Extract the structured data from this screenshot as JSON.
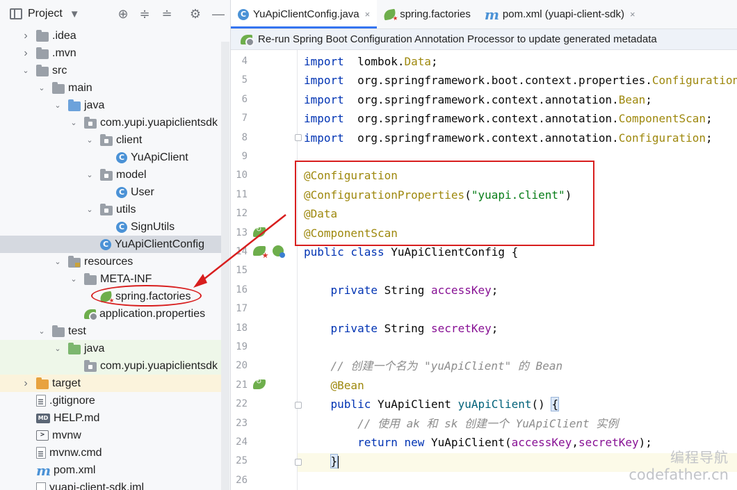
{
  "project_panel": {
    "title": "Project",
    "dropdown_glyph": "▼",
    "tools": [
      "locate-icon",
      "expand-all-icon",
      "collapse-all-icon",
      "gear-icon",
      "minimize-icon"
    ]
  },
  "tree": [
    {
      "label": ".idea",
      "icon": "folder-icon",
      "expanded": false,
      "depth": 0
    },
    {
      "label": ".mvn",
      "icon": "folder-icon",
      "expanded": false,
      "depth": 0
    },
    {
      "label": "src",
      "icon": "folder-icon",
      "expanded": true,
      "depth": 0
    },
    {
      "label": "main",
      "icon": "folder-icon",
      "expanded": true,
      "depth": 1
    },
    {
      "label": "java",
      "icon": "source-folder-icon",
      "expanded": true,
      "depth": 2
    },
    {
      "label": "com.yupi.yuapiclientsdk",
      "icon": "package-icon",
      "expanded": true,
      "depth": 3
    },
    {
      "label": "client",
      "icon": "package-icon",
      "expanded": true,
      "depth": 4
    },
    {
      "label": "YuApiClient",
      "icon": "class-icon",
      "depth": 5
    },
    {
      "label": "model",
      "icon": "package-icon",
      "expanded": true,
      "depth": 4
    },
    {
      "label": "User",
      "icon": "class-icon",
      "depth": 5
    },
    {
      "label": "utils",
      "icon": "package-icon",
      "expanded": true,
      "depth": 4
    },
    {
      "label": "SignUtils",
      "icon": "class-icon",
      "depth": 5
    },
    {
      "label": "YuApiClientConfig",
      "icon": "class-icon",
      "depth": 4,
      "selected": true
    },
    {
      "label": "resources",
      "icon": "resources-folder-icon",
      "expanded": true,
      "depth": 2
    },
    {
      "label": "META-INF",
      "icon": "folder-icon",
      "expanded": true,
      "depth": 3
    },
    {
      "label": "spring.factories",
      "icon": "spring-factories-icon",
      "depth": 4
    },
    {
      "label": "application.properties",
      "icon": "spring-properties-icon",
      "depth": 3
    },
    {
      "label": "test",
      "icon": "folder-icon",
      "expanded": true,
      "depth": 1
    },
    {
      "label": "java",
      "icon": "test-folder-icon",
      "expanded": true,
      "depth": 2,
      "test": true
    },
    {
      "label": "com.yupi.yuapiclientsdk",
      "icon": "package-icon",
      "depth": 3,
      "test": true
    },
    {
      "label": "target",
      "icon": "excluded-folder-icon",
      "expanded": false,
      "depth": 0,
      "target": true
    },
    {
      "label": ".gitignore",
      "icon": "gitignore-icon",
      "depth": 0
    },
    {
      "label": "HELP.md",
      "icon": "markdown-icon",
      "depth": 0
    },
    {
      "label": "mvnw",
      "icon": "script-icon",
      "depth": 0
    },
    {
      "label": "mvnw.cmd",
      "icon": "text-file-icon",
      "depth": 0
    },
    {
      "label": "pom.xml",
      "icon": "maven-icon",
      "depth": 0
    },
    {
      "label": "yuapi-client-sdk.iml",
      "icon": "iml-icon",
      "depth": 0
    }
  ],
  "tabs": [
    {
      "label": "YuApiClientConfig.java",
      "icon": "class-icon",
      "active": true,
      "close": "×"
    },
    {
      "label": "spring.factories",
      "icon": "spring-factories-icon",
      "active": false,
      "close": ""
    },
    {
      "label": "pom.xml (yuapi-client-sdk)",
      "icon": "maven-icon",
      "active": false,
      "close": "×"
    }
  ],
  "banner": {
    "text": "Re-run Spring Boot Configuration Annotation Processor to update generated metadata"
  },
  "icons": {
    "class_letter": "C",
    "markdown_letters": "MD",
    "script_glyph": ">",
    "maven_letter": "m"
  },
  "editor": {
    "current_line": 25,
    "lines": [
      {
        "n": "4",
        "tokens": [
          [
            "kw",
            "import"
          ],
          [
            "",
            "  lombok."
          ],
          [
            "ann",
            "Data"
          ],
          [
            "",
            ";"
          ]
        ]
      },
      {
        "n": "5",
        "tokens": [
          [
            "kw",
            "import"
          ],
          [
            "",
            "  org.springframework.boot.context.properties."
          ],
          [
            "ann",
            "ConfigurationProperties"
          ],
          [
            "",
            ";"
          ]
        ]
      },
      {
        "n": "6",
        "tokens": [
          [
            "kw",
            "import"
          ],
          [
            "",
            "  org.springframework.context.annotation."
          ],
          [
            "ann",
            "Bean"
          ],
          [
            "",
            ";"
          ]
        ]
      },
      {
        "n": "7",
        "tokens": [
          [
            "kw",
            "import"
          ],
          [
            "",
            "  org.springframework.context.annotation."
          ],
          [
            "ann",
            "ComponentScan"
          ],
          [
            "",
            ";"
          ]
        ]
      },
      {
        "n": "8",
        "tokens": [
          [
            "kw",
            "import"
          ],
          [
            "",
            "  org.springframework.context.annotation."
          ],
          [
            "ann",
            "Configuration"
          ],
          [
            "",
            ";"
          ]
        ]
      },
      {
        "n": "9",
        "tokens": []
      },
      {
        "n": "10",
        "tokens": [
          [
            "ann",
            "@Configuration"
          ]
        ]
      },
      {
        "n": "11",
        "tokens": [
          [
            "ann",
            "@ConfigurationProperties"
          ],
          [
            "",
            "("
          ],
          [
            "str",
            "\"yuapi.client\""
          ],
          [
            "",
            ")"
          ]
        ]
      },
      {
        "n": "12",
        "tokens": [
          [
            "ann",
            "@Data"
          ]
        ]
      },
      {
        "n": "13",
        "tokens": [
          [
            "ann",
            "@ComponentScan"
          ]
        ]
      },
      {
        "n": "14",
        "tokens": [
          [
            "kw",
            "public class"
          ],
          [
            "",
            " YuApiClientConfig {"
          ]
        ]
      },
      {
        "n": "15",
        "tokens": []
      },
      {
        "n": "16",
        "tokens": [
          [
            "",
            "    "
          ],
          [
            "kw",
            "private"
          ],
          [
            "",
            " String "
          ],
          [
            "fld",
            "accessKey"
          ],
          [
            "",
            ";"
          ]
        ]
      },
      {
        "n": "17",
        "tokens": []
      },
      {
        "n": "18",
        "tokens": [
          [
            "",
            "    "
          ],
          [
            "kw",
            "private"
          ],
          [
            "",
            " String "
          ],
          [
            "fld",
            "secretKey"
          ],
          [
            "",
            ";"
          ]
        ]
      },
      {
        "n": "19",
        "tokens": []
      },
      {
        "n": "20",
        "tokens": [
          [
            "",
            "    "
          ],
          [
            "cmt",
            "// 创建一个名为 \"yuApiClient\" 的 Bean"
          ]
        ]
      },
      {
        "n": "21",
        "tokens": [
          [
            "",
            "    "
          ],
          [
            "ann",
            "@Bean"
          ]
        ]
      },
      {
        "n": "22",
        "tokens": [
          [
            "",
            "    "
          ],
          [
            "kw",
            "public"
          ],
          [
            "",
            " YuApiClient "
          ],
          [
            "fn",
            "yuApiClient"
          ],
          [
            "",
            "() "
          ],
          [
            "brace",
            "{"
          ]
        ]
      },
      {
        "n": "23",
        "tokens": [
          [
            "",
            "        "
          ],
          [
            "cmt",
            "// 使用 ak 和 sk 创建一个 YuApiClient 实例"
          ]
        ]
      },
      {
        "n": "24",
        "tokens": [
          [
            "",
            "        "
          ],
          [
            "kw",
            "return new"
          ],
          [
            "",
            " YuApiClient("
          ],
          [
            "fld",
            "accessKey"
          ],
          [
            "",
            ","
          ],
          [
            "fld",
            "secretKey"
          ],
          [
            "",
            ");"
          ]
        ]
      },
      {
        "n": "25",
        "tokens": [
          [
            "",
            "    "
          ],
          [
            "brace",
            "}"
          ],
          [
            "caret",
            ""
          ]
        ]
      },
      {
        "n": "26",
        "tokens": []
      }
    ]
  },
  "watermark": {
    "line1": "编程导航",
    "line2": "codefather.cn"
  },
  "colors": {
    "keyword": "#0033b3",
    "annotation": "#9e880d",
    "string": "#067d17",
    "field": "#871094",
    "comment": "#8c8c8c",
    "highlight_red": "#d81e1e",
    "tab_active": "#3574f0"
  }
}
